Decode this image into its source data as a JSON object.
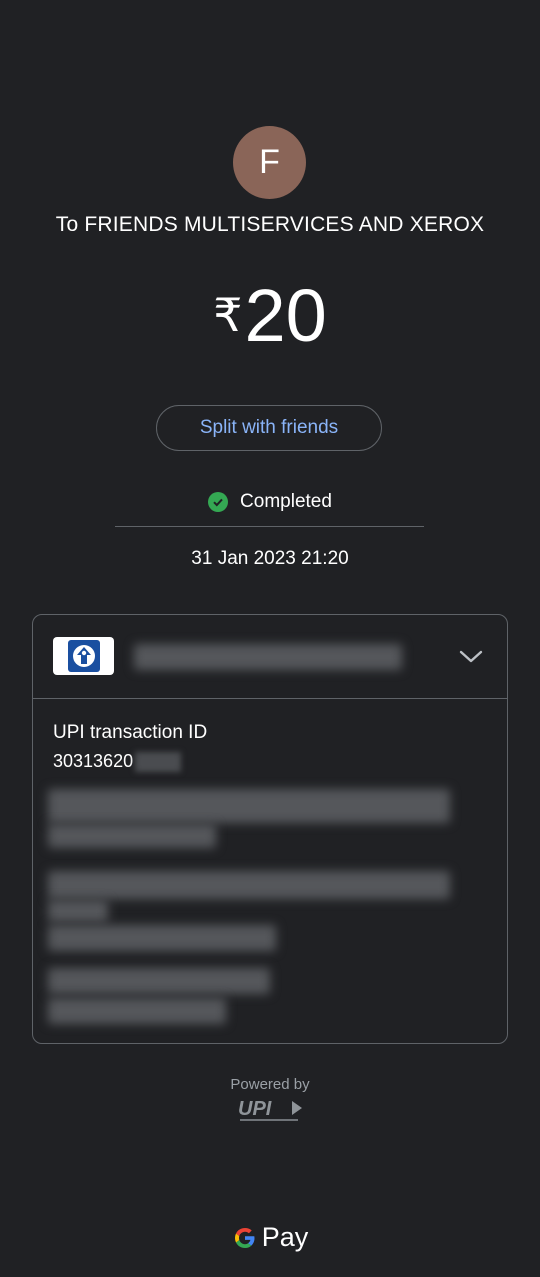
{
  "avatar": {
    "initial": "F",
    "color": "#8a6558"
  },
  "recipient": {
    "text": "To FRIENDS MULTISERVICES AND XEROX"
  },
  "payment": {
    "currency_symbol": "₹",
    "amount": "20"
  },
  "actions": {
    "split_label": "Split with friends"
  },
  "status": {
    "label": "Completed",
    "icon": "check-circle-icon",
    "color": "#34a853"
  },
  "datetime": "31 Jan 2023 21:20",
  "account": {
    "bank_logo_icon": "bank-logo-icon",
    "expand_icon": "chevron-down-icon"
  },
  "transaction": {
    "id_label": "UPI transaction ID",
    "id_value_visible": "30313620"
  },
  "footer": {
    "powered_by": "Powered by",
    "upi_logo": "UPI",
    "brand_logo": "Pay"
  },
  "colors": {
    "background": "#202124",
    "accent_link": "#8ab4f8"
  }
}
